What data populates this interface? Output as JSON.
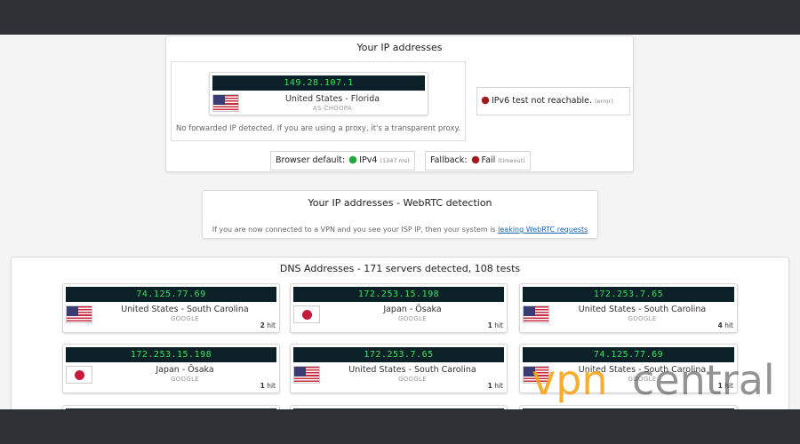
{
  "ip_panel": {
    "title": "Your IP addresses",
    "ip": "149.28.107.1",
    "location": "United States - Florida",
    "isp": "AS-CHOOPA",
    "flag": "us",
    "forward_note": "No forwarded IP detected. If you are using a proxy, it's a transparent proxy.",
    "ipv6_text": "IPv6 test not reachable.",
    "ipv6_detail": "(error)",
    "browser_default_label": "Browser default:",
    "browser_default_value": "IPv4",
    "browser_default_time": "(1347 ms)",
    "fallback_label": "Fallback:",
    "fallback_value": "Fail",
    "fallback_detail": "(timeout)"
  },
  "webrtc_panel": {
    "title": "Your IP addresses - WebRTC detection",
    "note": "If you are now connected to a VPN and you see your ISP IP, then your system is",
    "link_text": "leaking WebRTC requests"
  },
  "dns_panel": {
    "title": "DNS Addresses - 171 servers detected, 108 tests",
    "cards": [
      {
        "ip": "74.125.77.69",
        "location": "United States - South Carolina",
        "isp": "GOOGLE",
        "flag": "us",
        "hits": "2",
        "hit_label": "hit"
      },
      {
        "ip": "172.253.15.198",
        "location": "Japan - Ōsaka",
        "isp": "GOOGLE",
        "flag": "jp",
        "hits": "1",
        "hit_label": "hit"
      },
      {
        "ip": "172.253.7.65",
        "location": "United States - South Carolina",
        "isp": "GOOGLE",
        "flag": "us",
        "hits": "4",
        "hit_label": "hit"
      },
      {
        "ip": "172.253.15.198",
        "location": "Japan - Ōsaka",
        "isp": "GOOGLE",
        "flag": "jp",
        "hits": "1",
        "hit_label": "hit"
      },
      {
        "ip": "172.253.7.65",
        "location": "United States - South Carolina",
        "isp": "GOOGLE",
        "flag": "us",
        "hits": "1",
        "hit_label": "hit"
      },
      {
        "ip": "74.125.77.69",
        "location": "United States - South Carolina",
        "isp": "GOOGLE",
        "flag": "us",
        "hits": "1",
        "hit_label": "hit"
      }
    ]
  },
  "watermark": {
    "text": "vpncentral"
  },
  "colors": {
    "ip_bar_bg": "#0c2127",
    "ip_text": "#35e25e",
    "status_red": "#a31a1a",
    "status_green": "#21a83a",
    "link": "#1a63b3"
  }
}
